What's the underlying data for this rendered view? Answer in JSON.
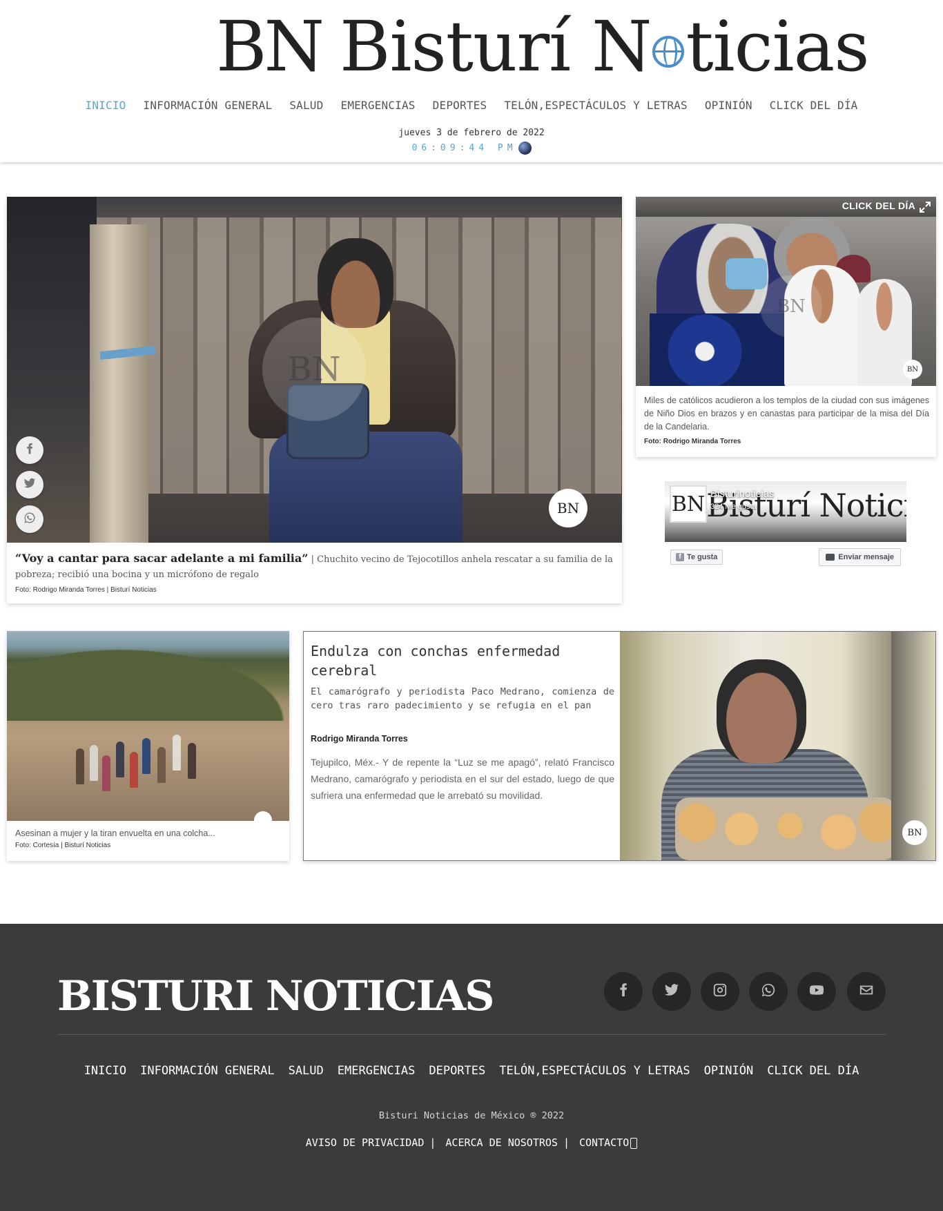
{
  "site": {
    "logo_monogram": "BN",
    "logo_part1": "Bisturí N",
    "logo_part2": "ticias"
  },
  "nav": {
    "items": [
      "INICIO",
      "INFORMACIÓN GENERAL",
      "SALUD",
      "EMERGENCIAS",
      "DEPORTES",
      "TELÓN,ESPECTÁCULOS Y LETRAS",
      "OPINIÓN",
      "CLICK DEL DÍA"
    ],
    "active": "INICIO"
  },
  "date": {
    "text": "jueves 3 de febrero de 2022",
    "time": "06:09:44 PM"
  },
  "feature": {
    "headline": "“Voy a cantar para sacar adelante a mi familia”",
    "separator": "|",
    "summary": "Chuchito vecino de Tejocotillos anhela rescatar a su familia de la pobreza; recibió una bocina y un micrófono de regalo",
    "credit": "Foto: Rodrigo Miranda Torres | Bisturí Noticias",
    "watermark": "BN",
    "badge": "BN"
  },
  "share": {
    "facebook_icon": "facebook-icon",
    "twitter_icon": "twitter-icon",
    "whatsapp_icon": "whatsapp-icon"
  },
  "click_del_dia": {
    "label": "CLICK DEL DÍA",
    "text": "Miles de católicos acudieron a los templos de la ciudad con sus imágenes de Niño Dios en brazos y en canastas para participar de la misa del Día de la Candelaria.",
    "credit": "Foto: Rodrigo Miranda Torres",
    "badge": "BN",
    "watermark": "BN"
  },
  "facebook_widget": {
    "cover_text": "Bisturí Noticias",
    "thumb": "BN",
    "page_name": "Bisturinoticias",
    "likes": "324 Me gusta",
    "like_button": "Te gusta",
    "message_button": "Enviar mensaje"
  },
  "card_left": {
    "text": "Asesinan a mujer y la tiran envuelta en una colcha...",
    "credit": "Foto: Cortesía | Bisturí Noticias"
  },
  "card_right": {
    "title": "Endulza con conchas enfermedad cerebral",
    "subtitle": "El camarógrafo y periodista Paco Medrano, comienza de cero tras raro padecimiento y se refugia en el pan",
    "author": "Rodrigo Miranda Torres",
    "body": "Tejupilco, Méx.- Y de repente la “Luz se me apagó”, relató Francisco Medrano, camarógrafo y periodista en el sur del estado, luego de que sufriera una enfermedad que le arrebató su movilidad.",
    "badge": "BN"
  },
  "footer": {
    "brand": "BISTURI NOTICIAS",
    "social": [
      "facebook-icon",
      "twitter-icon",
      "instagram-icon",
      "whatsapp-icon",
      "youtube-icon",
      "mail-icon"
    ],
    "nav": [
      "INICIO",
      "INFORMACIÓN GENERAL",
      "SALUD",
      "EMERGENCIAS",
      "DEPORTES",
      "TELÓN,ESPECTÁCULOS Y LETRAS",
      "OPINIÓN",
      "CLICK DEL DÍA"
    ],
    "copyright": "Bisturi Noticias de México ® 2022",
    "legal": [
      "AVISO DE PRIVACIDAD",
      "ACERCA DE NOSOTROS",
      "CONTACTO"
    ],
    "legal_separator": "|"
  },
  "colors": {
    "accent": "#5ba3d0",
    "footer_bg": "#3b3b3b",
    "social_bg": "#262626"
  }
}
